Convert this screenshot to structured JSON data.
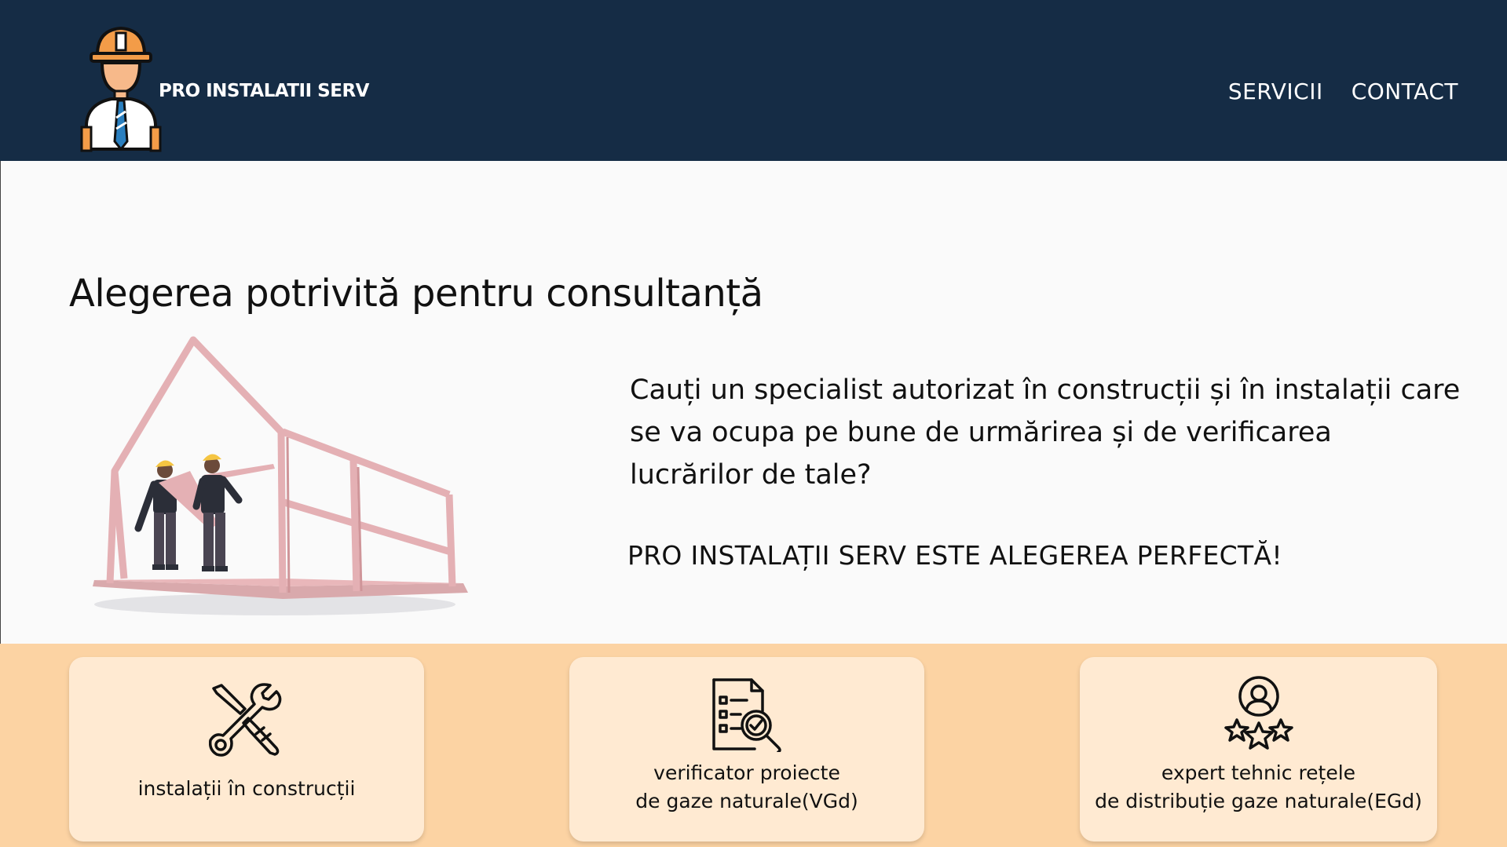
{
  "header": {
    "brand": "PRO INSTALATII SERV",
    "nav": {
      "services_label": "SERVICII",
      "contact_label": "CONTACT"
    },
    "logo_icon": "engineer-hardhat-icon"
  },
  "hero": {
    "title": "Alegerea potrivită pentru consultanță",
    "lead": "Cauți un specialist autorizat în construcții și în instalații care se va ocupa pe bune de urmărirea și de verificarea lucrărilor de tale?",
    "tagline": "PRO INSTALAȚII SERV ESTE ALEGEREA PERFECTĂ!",
    "illustration": "workers-house-frame-illustration"
  },
  "services": [
    {
      "icon": "wrench-screwdriver-icon",
      "line1": "instalații în construcții",
      "line2": ""
    },
    {
      "icon": "document-search-icon",
      "line1": "verificator proiecte",
      "line2": "de gaze naturale(VGd)"
    },
    {
      "icon": "expert-stars-icon",
      "line1": "expert tehnic rețele",
      "line2": "de distribuție gaze naturale(EGd)"
    }
  ],
  "colors": {
    "header_bg": "#152c45",
    "band_bg": "#fcd3a3",
    "card_bg": "#ffead2",
    "accent": "#f39c48"
  }
}
